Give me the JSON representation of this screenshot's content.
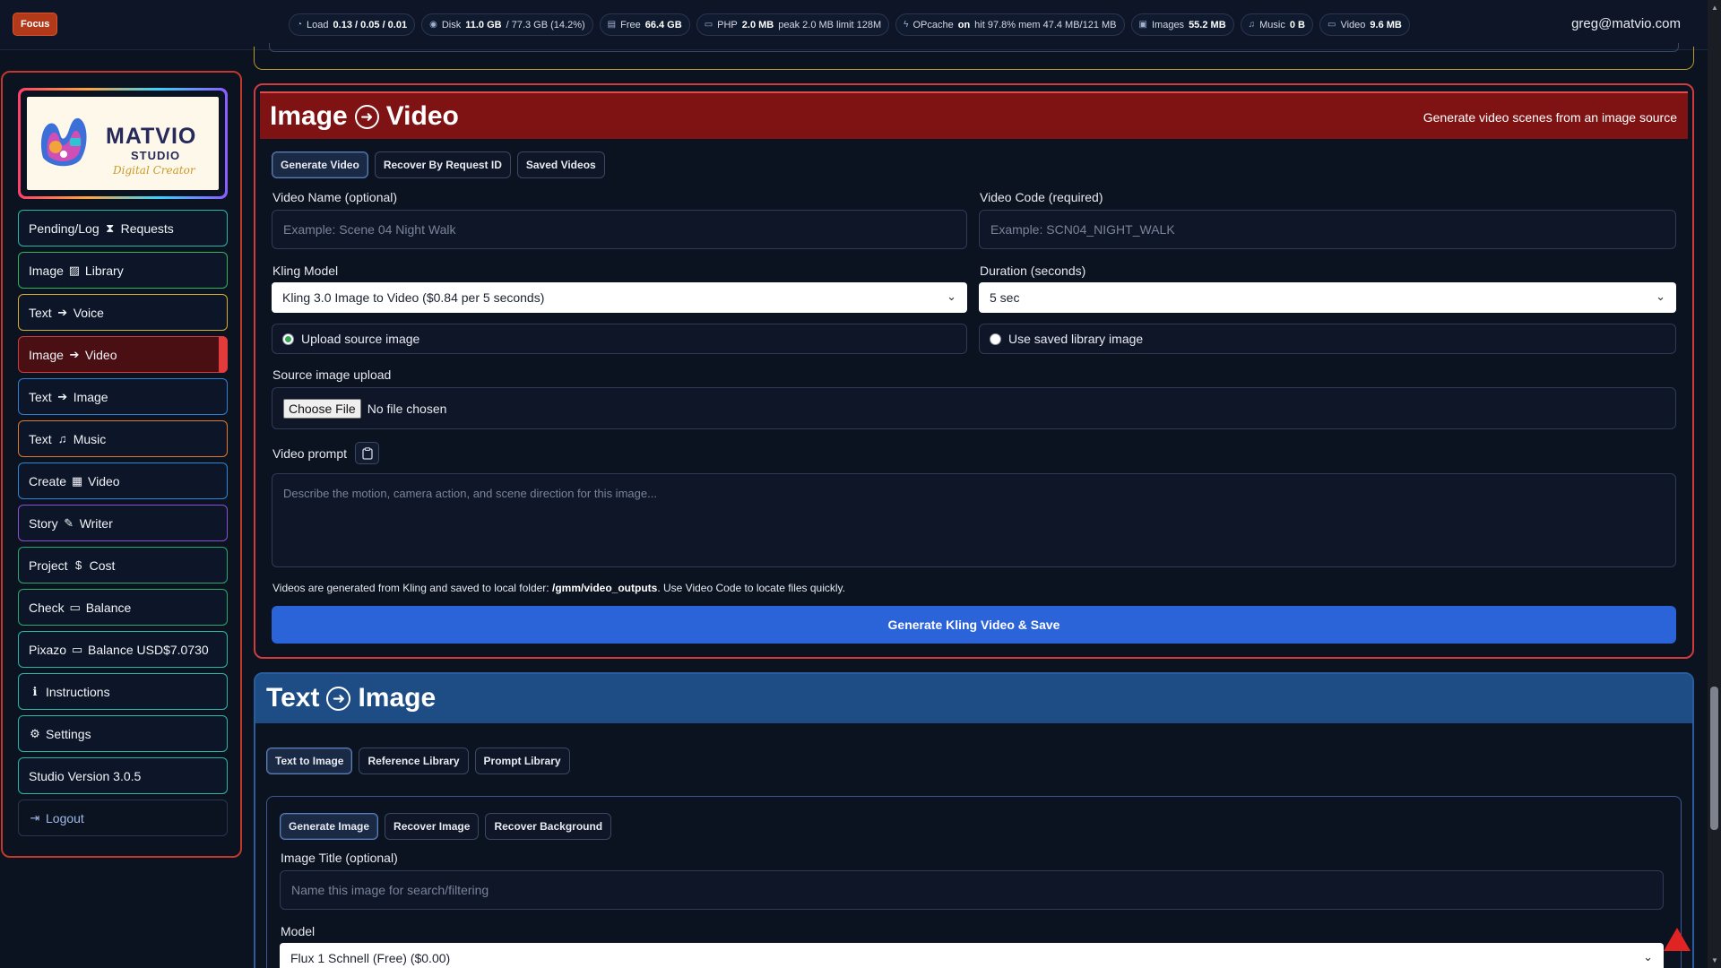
{
  "topbar": {
    "focus_label": "Focus",
    "stats": [
      {
        "icon": "gauge-icon",
        "glyph": "◔",
        "label": "Load",
        "value": "0.13 / 0.05 / 0.01",
        "extra": ""
      },
      {
        "icon": "disk-icon",
        "glyph": "◉",
        "label": "Disk",
        "value": "11.0 GB",
        "extra": "/ 77.3 GB (14.2%)"
      },
      {
        "icon": "storage-icon",
        "glyph": "▤",
        "label": "Free",
        "value": "66.4 GB",
        "extra": ""
      },
      {
        "icon": "memory-icon",
        "glyph": "▭",
        "label": "PHP",
        "value": "2.0 MB",
        "extra": "peak 2.0 MB limit 128M"
      },
      {
        "icon": "lightning-icon",
        "glyph": "ϟ",
        "label": "OPcache",
        "value": "on",
        "extra": "hit 97.8% mem 47.4 MB/121 MB"
      },
      {
        "icon": "image-icon",
        "glyph": "▣",
        "label": "Images",
        "value": "55.2 MB",
        "extra": ""
      },
      {
        "icon": "music-icon",
        "glyph": "♫",
        "label": "Music",
        "value": "0 B",
        "extra": ""
      },
      {
        "icon": "video-icon",
        "glyph": "▭",
        "label": "Video",
        "value": "9.6 MB",
        "extra": ""
      }
    ],
    "user_email": "greg@matvio.com"
  },
  "sidebar": {
    "logo": {
      "title": "MATVIO",
      "subtitle": "STUDIO",
      "script": "Digital Creator"
    },
    "items": [
      {
        "name": "sidebar-item-pending-requests",
        "pre": "Pending/Log",
        "glyph": "⧗",
        "post": "Requests",
        "color": "#2bb7a6"
      },
      {
        "name": "sidebar-item-image-library",
        "pre": "Image",
        "glyph": "▨",
        "post": "Library",
        "color": "#2fb35a"
      },
      {
        "name": "sidebar-item-text-voice",
        "pre": "Text",
        "glyph": "➔",
        "post": "Voice",
        "color": "#d4b02a"
      },
      {
        "name": "sidebar-item-image-video",
        "pre": "Image",
        "glyph": "➔",
        "post": "Video",
        "color": "#d23b3b"
      },
      {
        "name": "sidebar-item-text-image",
        "pre": "Text",
        "glyph": "➔",
        "post": "Image",
        "color": "#2f7fd3"
      },
      {
        "name": "sidebar-item-text-music",
        "pre": "Text",
        "glyph": "♫",
        "post": "Music",
        "color": "#e07a2a"
      },
      {
        "name": "sidebar-item-create-video",
        "pre": "Create",
        "glyph": "▦",
        "post": "Video",
        "color": "#2a86d8"
      },
      {
        "name": "sidebar-item-story-writer",
        "pre": "Story",
        "glyph": "✎",
        "post": "Writer",
        "color": "#8e4fd6"
      },
      {
        "name": "sidebar-item-project-cost",
        "pre": "Project",
        "glyph": "$",
        "post": "Cost",
        "color": "#2ba86a"
      },
      {
        "name": "sidebar-item-check-balance",
        "pre": "Check",
        "glyph": "▭",
        "post": "Balance",
        "color": "#2ba86a"
      },
      {
        "name": "sidebar-item-pixazo-balance",
        "pre": "Pixazo",
        "glyph": "▭",
        "post": "Balance USD$7.0730",
        "color": "#2bb7a6"
      },
      {
        "name": "sidebar-item-instructions",
        "pre": "",
        "glyph": "ℹ",
        "post": "Instructions",
        "color": "#2bb7a6"
      },
      {
        "name": "sidebar-item-settings",
        "pre": "",
        "glyph": "⚙",
        "post": "Settings",
        "color": "#2bb7a6"
      },
      {
        "name": "sidebar-item-studio-version",
        "pre": "Studio Version 3.0.5",
        "glyph": "",
        "post": "",
        "color": "#2bb7a6"
      },
      {
        "name": "sidebar-item-logout",
        "pre": "",
        "glyph": "⇥",
        "post": "Logout",
        "color": "#2a3550"
      }
    ]
  },
  "image_video": {
    "title_left": "Image",
    "title_right": "Video",
    "subtitle": "Generate video scenes from an image source",
    "tabs": [
      "Generate Video",
      "Recover By Request ID",
      "Saved Videos"
    ],
    "video_name_label": "Video Name (optional)",
    "video_name_placeholder": "Example: Scene 04 Night Walk",
    "video_code_label": "Video Code (required)",
    "video_code_placeholder": "Example: SCN04_NIGHT_WALK",
    "model_label": "Kling Model",
    "model_value": "Kling 3.0 Image to Video ($0.84 per 5 seconds)",
    "duration_label": "Duration (seconds)",
    "duration_value": "5 sec",
    "radio_upload": "Upload source image",
    "radio_library": "Use saved library image",
    "upload_label": "Source image upload",
    "choose_file": "Choose File",
    "no_file": "No file chosen",
    "prompt_label": "Video prompt",
    "prompt_placeholder": "Describe the motion, camera action, and scene direction for this image...",
    "note_pre": "Videos are generated from Kling and saved to local folder: ",
    "note_path": "/gmm/video_outputs",
    "note_post": ". Use Video Code to locate files quickly.",
    "generate_button": "Generate Kling Video & Save"
  },
  "text_image": {
    "title_left": "Text",
    "title_right": "Image",
    "tabs": [
      "Text to Image",
      "Reference Library",
      "Prompt Library"
    ],
    "inner_tabs": [
      "Generate Image",
      "Recover Image",
      "Recover Background"
    ],
    "title_label": "Image Title (optional)",
    "title_placeholder": "Name this image for search/filtering",
    "model_label": "Model",
    "model_value": "Flux 1 Schnell (Free) ($0.00)"
  }
}
